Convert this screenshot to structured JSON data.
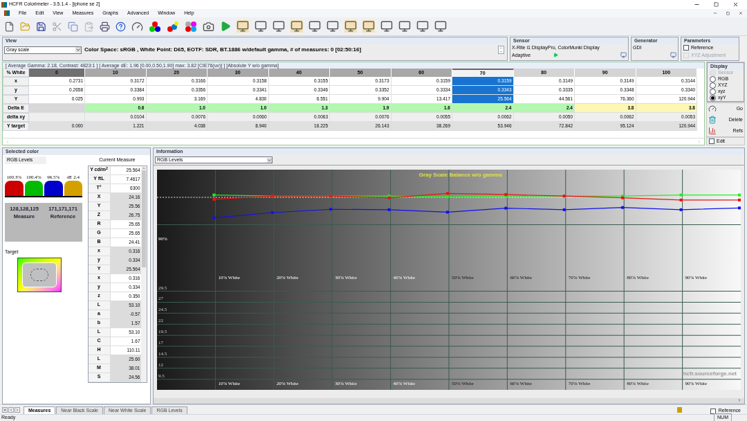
{
  "window": {
    "title": "HCFR Colorimeter - 3.5.1.4 - [iphone se 2]"
  },
  "menu": [
    "File",
    "Edit",
    "View",
    "Measures",
    "Graphs",
    "Advanced",
    "Window",
    "Help"
  ],
  "view": {
    "title": "View",
    "mode": "Gray scale",
    "info": "Color Space: sRGB , White Point: D65, EOTF:  SDR, BT.1886 w/default gamma, # of measures: 0 [02:50:16]"
  },
  "sensor": {
    "title": "Sensor",
    "name": "X-Rite i1 DisplayPro, ColorMunki Display",
    "mode": "Adaptive"
  },
  "generator": {
    "title": "Generator",
    "name": "GDI"
  },
  "parameters": {
    "title": "Parameters",
    "options": [
      {
        "label": "Reference",
        "checked": false,
        "disabled": false
      },
      {
        "label": "XYZ Adjustment",
        "checked": false,
        "disabled": true
      }
    ]
  },
  "summary": "[ Average Gamma: 2.18, Contrast: 4823:1 ] [ Average dE: 1.96 [0.00,0.50,1.90] max: 3.82 [CIE76(uv)] ] [Absolute Y w/o gamma]",
  "table": {
    "corner": "% White",
    "columns": [
      {
        "label": "0",
        "selected": false
      },
      {
        "label": "10",
        "selected": false
      },
      {
        "label": "20",
        "selected": false
      },
      {
        "label": "30",
        "selected": false
      },
      {
        "label": "40",
        "selected": false
      },
      {
        "label": "50",
        "selected": false
      },
      {
        "label": "60",
        "selected": false
      },
      {
        "label": "70",
        "selected": true
      },
      {
        "label": "80",
        "selected": false
      },
      {
        "label": "90",
        "selected": false
      },
      {
        "label": "100",
        "selected": false
      }
    ],
    "rows": [
      {
        "label": "x",
        "kind": "measure",
        "cells": [
          "0.2731",
          "0.3172",
          "0.3166",
          "0.3158",
          "0.3155",
          "0.3173",
          "0.3159",
          "0.3159",
          "0.3149",
          "0.3149",
          "0.3144"
        ]
      },
      {
        "label": "y",
        "kind": "measure",
        "cells": [
          "0.2658",
          "0.3384",
          "0.3356",
          "0.3341",
          "0.3346",
          "0.3352",
          "0.3334",
          "0.3343",
          "0.3335",
          "0.3348",
          "0.3340"
        ]
      },
      {
        "label": "Y",
        "kind": "measure",
        "cells": [
          "0.025",
          "0.993",
          "3.169",
          "4.830",
          "6.551",
          "9.904",
          "13.417",
          "25.564",
          "44.561",
          "76.360",
          "120.944"
        ]
      },
      {
        "label": "Delta E",
        "kind": "delta",
        "cells": [
          {
            "text": ""
          },
          {
            "text": "0.6",
            "color": "#b3f7b0"
          },
          {
            "text": "1.0",
            "color": "#b3f7b0"
          },
          {
            "text": "1.0",
            "color": "#b3f7b0"
          },
          {
            "text": "1.3",
            "color": "#b3f7b0"
          },
          {
            "text": "1.9",
            "color": "#b3f7b0"
          },
          {
            "text": "1.6",
            "color": "#b3f7b0"
          },
          {
            "text": "2.4",
            "color": "#b3f7b0"
          },
          {
            "text": "2.4",
            "color": "#b3f7b0"
          },
          {
            "text": "3.8",
            "color": "#fdf7b5"
          },
          {
            "text": "3.8",
            "color": "#fdf7b5"
          }
        ]
      },
      {
        "label": "delta xy",
        "kind": "info",
        "cells": [
          "",
          "0.0104",
          "0.0076",
          "0.0060",
          "0.0063",
          "0.0076",
          "0.0055",
          "0.0062",
          "0.0050",
          "0.0062",
          "0.0053"
        ]
      },
      {
        "label": "Y target",
        "kind": "target",
        "cells": [
          "0.000",
          "1.221",
          "4.038",
          "8.940",
          "16.225",
          "26.143",
          "38.269",
          "53.946",
          "72.842",
          "95.124",
          "120.944"
        ]
      }
    ]
  },
  "display": {
    "title": "Display",
    "options": [
      {
        "label": "Sensor",
        "selected": false,
        "disabled": true
      },
      {
        "label": "RGB",
        "selected": false,
        "disabled": false
      },
      {
        "label": "XYZ",
        "selected": false,
        "disabled": false
      },
      {
        "label": "xyz",
        "selected": false,
        "disabled": false
      },
      {
        "label": "xyY",
        "selected": true,
        "disabled": false
      }
    ],
    "buttons": [
      {
        "kind": "go",
        "label": "Go"
      },
      {
        "kind": "delete",
        "label": "Delete"
      },
      {
        "kind": "refs",
        "label": "Refs"
      }
    ],
    "edit": {
      "label": "Edit",
      "checked": false
    }
  },
  "selected_color": {
    "title": "Selected color",
    "subtitle": "RGB Levels",
    "bars": [
      {
        "label": "100.3%",
        "color": "#cc0000"
      },
      {
        "label": "100.4%",
        "color": "#00bb00"
      },
      {
        "label": "96.5%",
        "color": "#0000cc"
      },
      {
        "label": "dE 2.4",
        "color": "#d4a000"
      }
    ],
    "values": [
      {
        "rgb": "128,128,125",
        "caption": "Measure"
      },
      {
        "rgb": "171,171,171",
        "caption": "Reference"
      }
    ],
    "target_label": "Target"
  },
  "current_measure": {
    "title": "Current Measure",
    "rows": [
      {
        "label": "Y cd/m$^{2}$",
        "value": "25.564",
        "shaded": false
      },
      {
        "label": "Y ftL",
        "value": "7.4617",
        "shaded": false
      },
      {
        "label": "T°",
        "value": "6300",
        "shaded": false
      },
      {
        "label": "X",
        "value": "24.16",
        "shaded": true
      },
      {
        "label": "Y",
        "value": "25.56",
        "shaded": true
      },
      {
        "label": "Z",
        "value": "26.75",
        "shaded": true
      },
      {
        "label": "R",
        "value": "25.65",
        "shaded": false
      },
      {
        "label": "G",
        "value": "25.65",
        "shaded": false
      },
      {
        "label": "B",
        "value": "24.41",
        "shaded": false
      },
      {
        "label": "x",
        "value": "0.316",
        "shaded": true
      },
      {
        "label": "y",
        "value": "0.334",
        "shaded": true
      },
      {
        "label": "Y",
        "value": "25.564",
        "shaded": true
      },
      {
        "label": "x",
        "value": "0.316",
        "shaded": false
      },
      {
        "label": "y",
        "value": "0.334",
        "shaded": false
      },
      {
        "label": "z",
        "value": "0.350",
        "shaded": false
      },
      {
        "label": "L",
        "value": "53.10",
        "shaded": true
      },
      {
        "label": "a",
        "value": "-0.57",
        "shaded": true
      },
      {
        "label": "b",
        "value": "1.57",
        "shaded": true
      },
      {
        "label": "L",
        "value": "53.10",
        "shaded": false
      },
      {
        "label": "C",
        "value": "1.67",
        "shaded": false
      },
      {
        "label": "H",
        "value": "110.11",
        "shaded": false
      },
      {
        "label": "L",
        "value": "25.60",
        "shaded": true
      },
      {
        "label": "M",
        "value": "38.01",
        "shaded": true
      },
      {
        "label": "S",
        "value": "24.56",
        "shaded": true
      }
    ]
  },
  "information": {
    "title": "Information",
    "mode": "RGB Levels",
    "chart": {
      "title": "Gray Scale Balance w/o gamma",
      "upper_tick": "90%",
      "x_labels": [
        "10% White",
        "20% White",
        "30% White",
        "40% White",
        "50% White",
        "60% White",
        "70% White",
        "80% White",
        "90% White"
      ],
      "lower_ticks": [
        "29.5",
        "27",
        "24.5",
        "22",
        "19.5",
        "17",
        "14.5",
        "12",
        "9.5"
      ],
      "x_labels_bottom": [
        "10% White",
        "20% White",
        "30% White",
        "40% White",
        "50% White",
        "60% White",
        "70% White",
        "80% White",
        "90% White"
      ],
      "credit": "hcfr.sourceforge.net"
    }
  },
  "sheet_tabs": [
    {
      "label": "Measures",
      "selected": true
    },
    {
      "label": "Near Black Scale",
      "selected": false
    },
    {
      "label": "Near White Scale",
      "selected": false
    },
    {
      "label": "RGB Levels",
      "selected": false
    }
  ],
  "status_bar": {
    "text": "Ready",
    "reference": {
      "label": "Reference",
      "checked": false
    },
    "indicator": "NUM"
  }
}
